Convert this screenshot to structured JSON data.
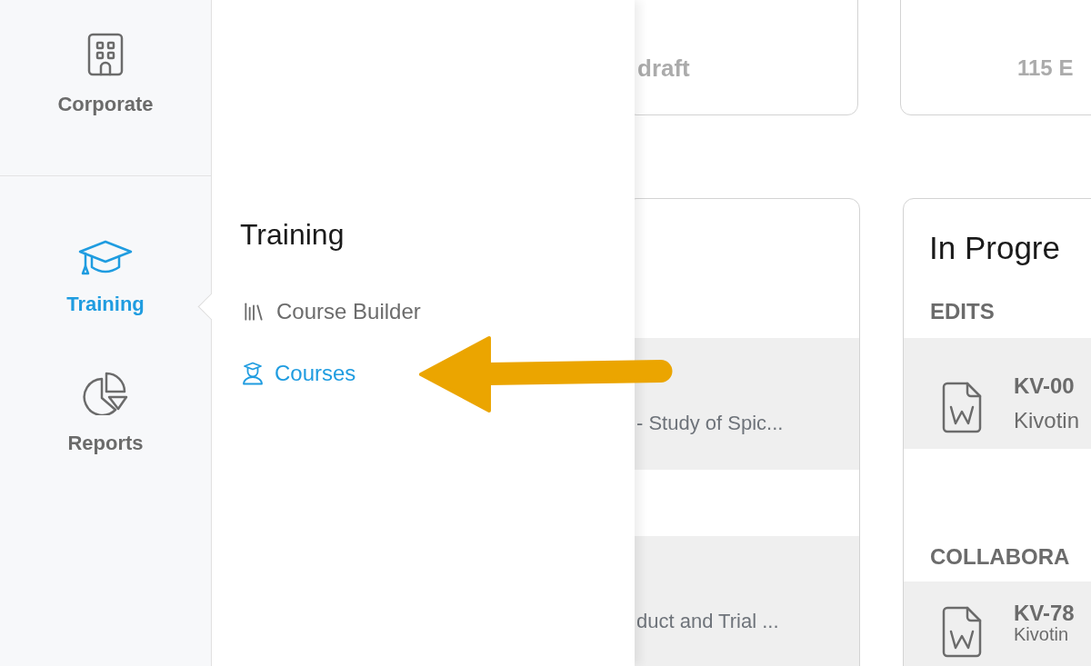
{
  "sidebar": {
    "items": [
      {
        "label": "Corporate",
        "selected": false
      },
      {
        "label": "Training",
        "selected": true
      },
      {
        "label": "Reports",
        "selected": false
      }
    ]
  },
  "flyout": {
    "title": "Training",
    "items": [
      {
        "label": "Course Builder",
        "selected": false
      },
      {
        "label": "Courses",
        "selected": true
      }
    ]
  },
  "dashboard": {
    "summary_cards": [
      {
        "text": "draft"
      },
      {
        "text": "115 E"
      }
    ],
    "course_list": {
      "rows": [
        {
          "title": "- Study of Spic..."
        },
        {
          "title": "duct and Trial ..."
        }
      ]
    },
    "in_progress": {
      "title": "In Progre",
      "sections": [
        {
          "heading": "EDITS",
          "items": [
            {
              "id": "KV-00",
              "subtitle": "Kivotin"
            }
          ]
        },
        {
          "heading": "COLLABORA",
          "items": [
            {
              "id": "KV-78",
              "subtitle": "Kivotin"
            }
          ]
        }
      ]
    }
  }
}
